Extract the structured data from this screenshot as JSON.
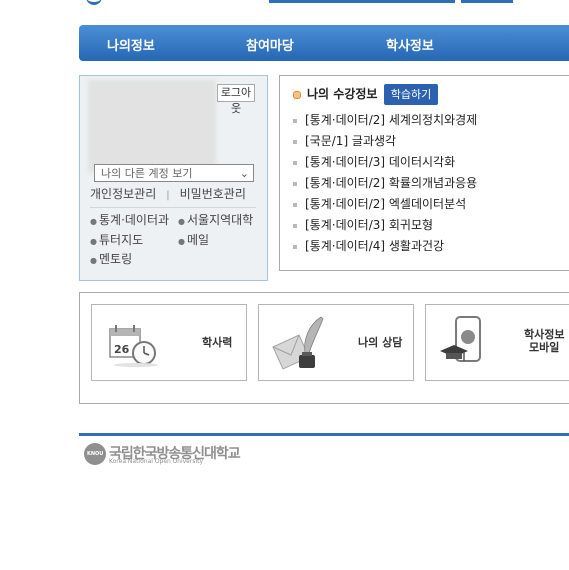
{
  "nav": {
    "items": [
      {
        "label": "나의정보"
      },
      {
        "label": "참여마당"
      },
      {
        "label": "학사정보"
      }
    ]
  },
  "user": {
    "logout_label": "로그아웃",
    "account_select": "나의 다른 계정 보기",
    "links": {
      "profile": "개인정보관리",
      "password": "비밀번호관리"
    },
    "services": [
      {
        "label": "통계·데이터과"
      },
      {
        "label": "서울지역대학"
      },
      {
        "label": "튜터지도"
      },
      {
        "label": "메일"
      },
      {
        "label": "멘토링"
      }
    ]
  },
  "courses": {
    "title": "나의 수강정보",
    "study_button": "학습하기",
    "items": [
      {
        "label": "[통계·데이터/2] 세계의정치와경제"
      },
      {
        "label": "[국문/1] 글과생각"
      },
      {
        "label": "[통계·데이터/3] 데이터시각화"
      },
      {
        "label": "[통계·데이터/2] 확률의개념과응용"
      },
      {
        "label": "[통계·데이터/2] 엑셀데이터분석"
      },
      {
        "label": "[통계·데이터/3] 회귀모형"
      },
      {
        "label": "[통계·데이터/4] 생활과건강"
      }
    ]
  },
  "quick": {
    "calendar": "학사력",
    "counsel": "나의 상담",
    "mobile_line1": "학사정보",
    "mobile_line2": "모바일"
  },
  "footer": {
    "logo_mark": "KNOU",
    "name_ko": "국립한국방송통신대학교",
    "name_en": "Korea National Open University"
  },
  "colors": {
    "accent": "#2f6fb6",
    "nav_bg": "#3a7cc7",
    "button": "#2c61b0",
    "panel_bg": "#edf1f4"
  }
}
